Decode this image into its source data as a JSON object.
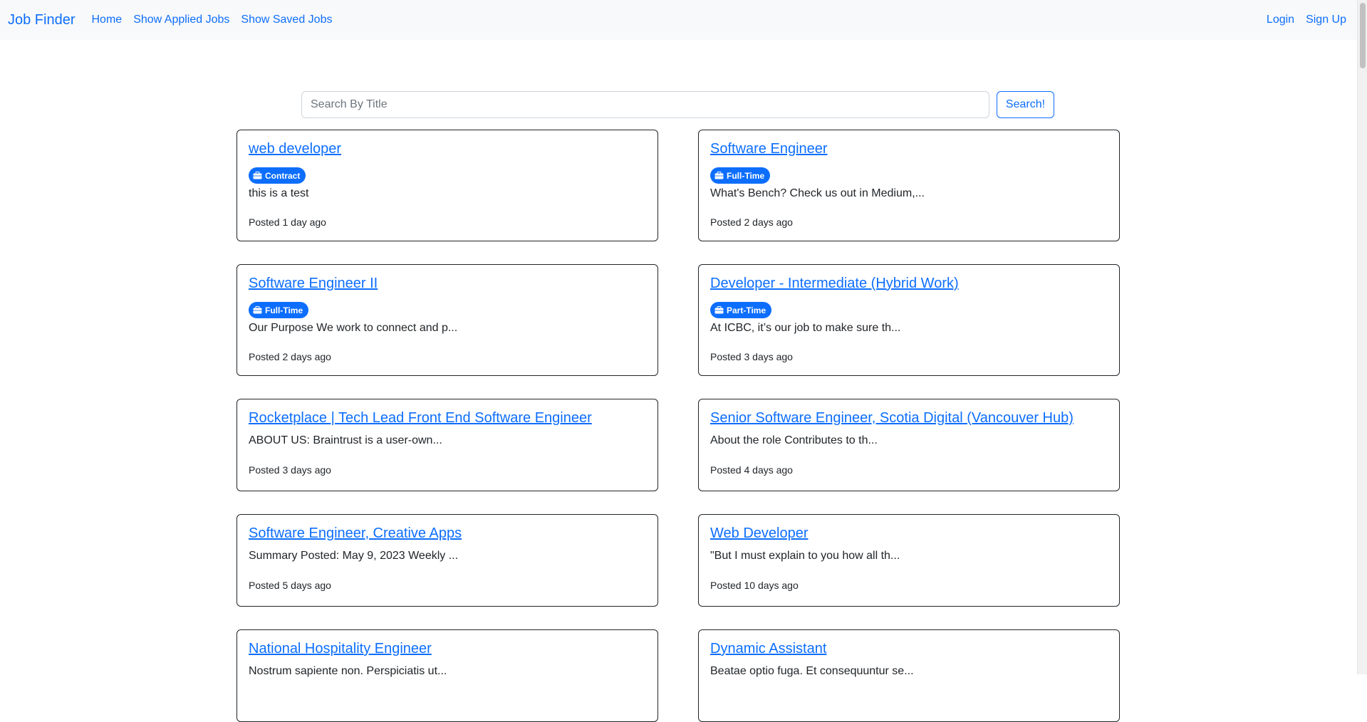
{
  "navbar": {
    "brand": "Job Finder",
    "links": [
      "Home",
      "Show Applied Jobs",
      "Show Saved Jobs"
    ],
    "right_links": [
      "Login",
      "Sign Up"
    ]
  },
  "search": {
    "placeholder": "Search By Title",
    "button_label": "Search!"
  },
  "job_type_icon": "briefcase-icon",
  "jobs": [
    {
      "title": "web developer",
      "type": "Contract",
      "description": "this is a test",
      "posted": "Posted 1 day ago"
    },
    {
      "title": "Software Engineer",
      "type": "Full-Time",
      "description": "What's Bench? Check us out in Medium,...",
      "posted": "Posted 2 days ago"
    },
    {
      "title": "Software Engineer II",
      "type": "Full-Time",
      "description": "Our Purpose We work to connect and p...",
      "posted": "Posted 2 days ago"
    },
    {
      "title": "Developer - Intermediate (Hybrid Work)",
      "type": "Part-Time",
      "description": "At ICBC, it’s our job to make sure th...",
      "posted": "Posted 3 days ago"
    },
    {
      "title": "Rocketplace | Tech Lead Front End Software Engineer",
      "type": "",
      "description": "ABOUT US: Braintrust is a user-own...",
      "posted": "Posted 3 days ago"
    },
    {
      "title": "Senior Software Engineer, Scotia Digital (Vancouver Hub)",
      "type": "",
      "description": "About the role Contributes to th...",
      "posted": "Posted 4 days ago"
    },
    {
      "title": "Software Engineer, Creative Apps",
      "type": "",
      "description": "Summary Posted: May 9, 2023 Weekly ...",
      "posted": "Posted 5 days ago"
    },
    {
      "title": "Web Developer",
      "type": "",
      "description": "\"But I must explain to you how all th...",
      "posted": "Posted 10 days ago"
    },
    {
      "title": "National Hospitality Engineer",
      "type": "",
      "description": "Nostrum sapiente non. Perspiciatis ut...",
      "posted": ""
    },
    {
      "title": "Dynamic Assistant",
      "type": "",
      "description": "Beatae optio fuga. Et consequuntur se...",
      "posted": ""
    }
  ],
  "colors": {
    "primary": "#0d6efd",
    "navbar_bg": "#f8f9fa",
    "text": "#212529"
  }
}
